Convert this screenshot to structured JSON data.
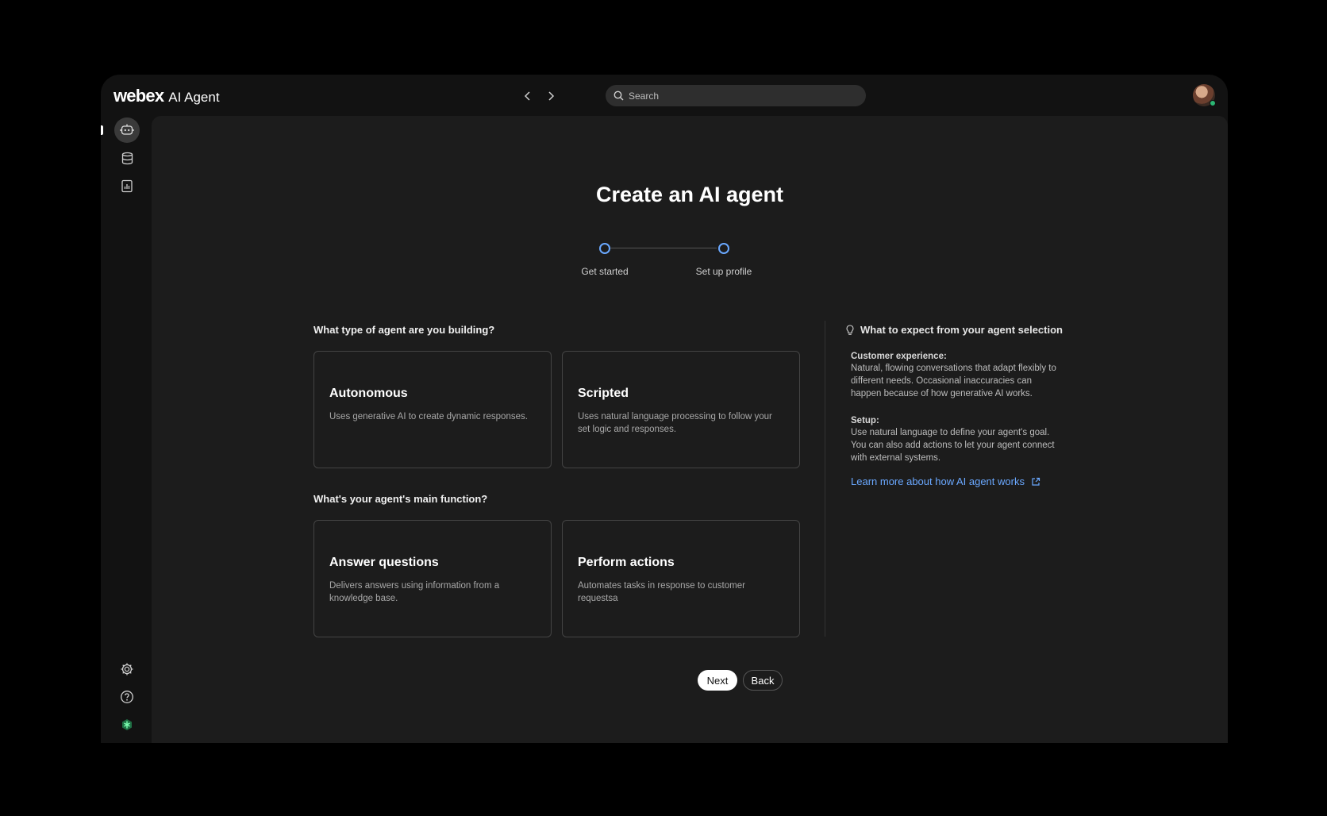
{
  "app": {
    "brand": "webex",
    "product": "AI Agent"
  },
  "topbar": {
    "search_placeholder": "Search",
    "back_icon": "chevron-left-icon",
    "forward_icon": "chevron-right-icon"
  },
  "sidebar": {
    "top_items": [
      "ai-agent-icon",
      "knowledge-database-icon",
      "analytics-report-icon"
    ],
    "bottom_items": [
      "settings-gear-icon",
      "help-icon",
      "status-icon"
    ],
    "active_index": 0
  },
  "main": {
    "title": "Create an AI agent",
    "steps": [
      {
        "label": "Get started"
      },
      {
        "label": "Set up profile"
      }
    ],
    "agent_type_question": "What type of agent are you building?",
    "agent_types": [
      {
        "title": "Autonomous",
        "description": "Uses generative AI to create dynamic responses."
      },
      {
        "title": "Scripted",
        "description": "Uses natural language processing to follow your set logic and responses."
      }
    ],
    "function_question": "What's your agent's main function?",
    "functions": [
      {
        "title": "Answer questions",
        "description": "Delivers answers using information from a knowledge base."
      },
      {
        "title": "Perform actions",
        "description": "Automates tasks in response to customer requestsa"
      }
    ],
    "info_panel": {
      "heading": "What to expect from your agent selection",
      "customer_experience_title": "Customer experience:",
      "customer_experience_text": "Natural, flowing conversations that adapt flexibly to different needs. Occasional inaccuracies can happen because of how generative AI works.",
      "setup_title": "Setup:",
      "setup_text": "Use natural language to define your agent's goal. You can also add actions to let your agent connect with external systems.",
      "link_text": "Learn more about how AI agent works"
    },
    "buttons": {
      "next": "Next",
      "back": "Back"
    }
  },
  "colors": {
    "accent": "#6aa8ff",
    "background": "#1c1c1c",
    "status_green": "#2bb673"
  }
}
